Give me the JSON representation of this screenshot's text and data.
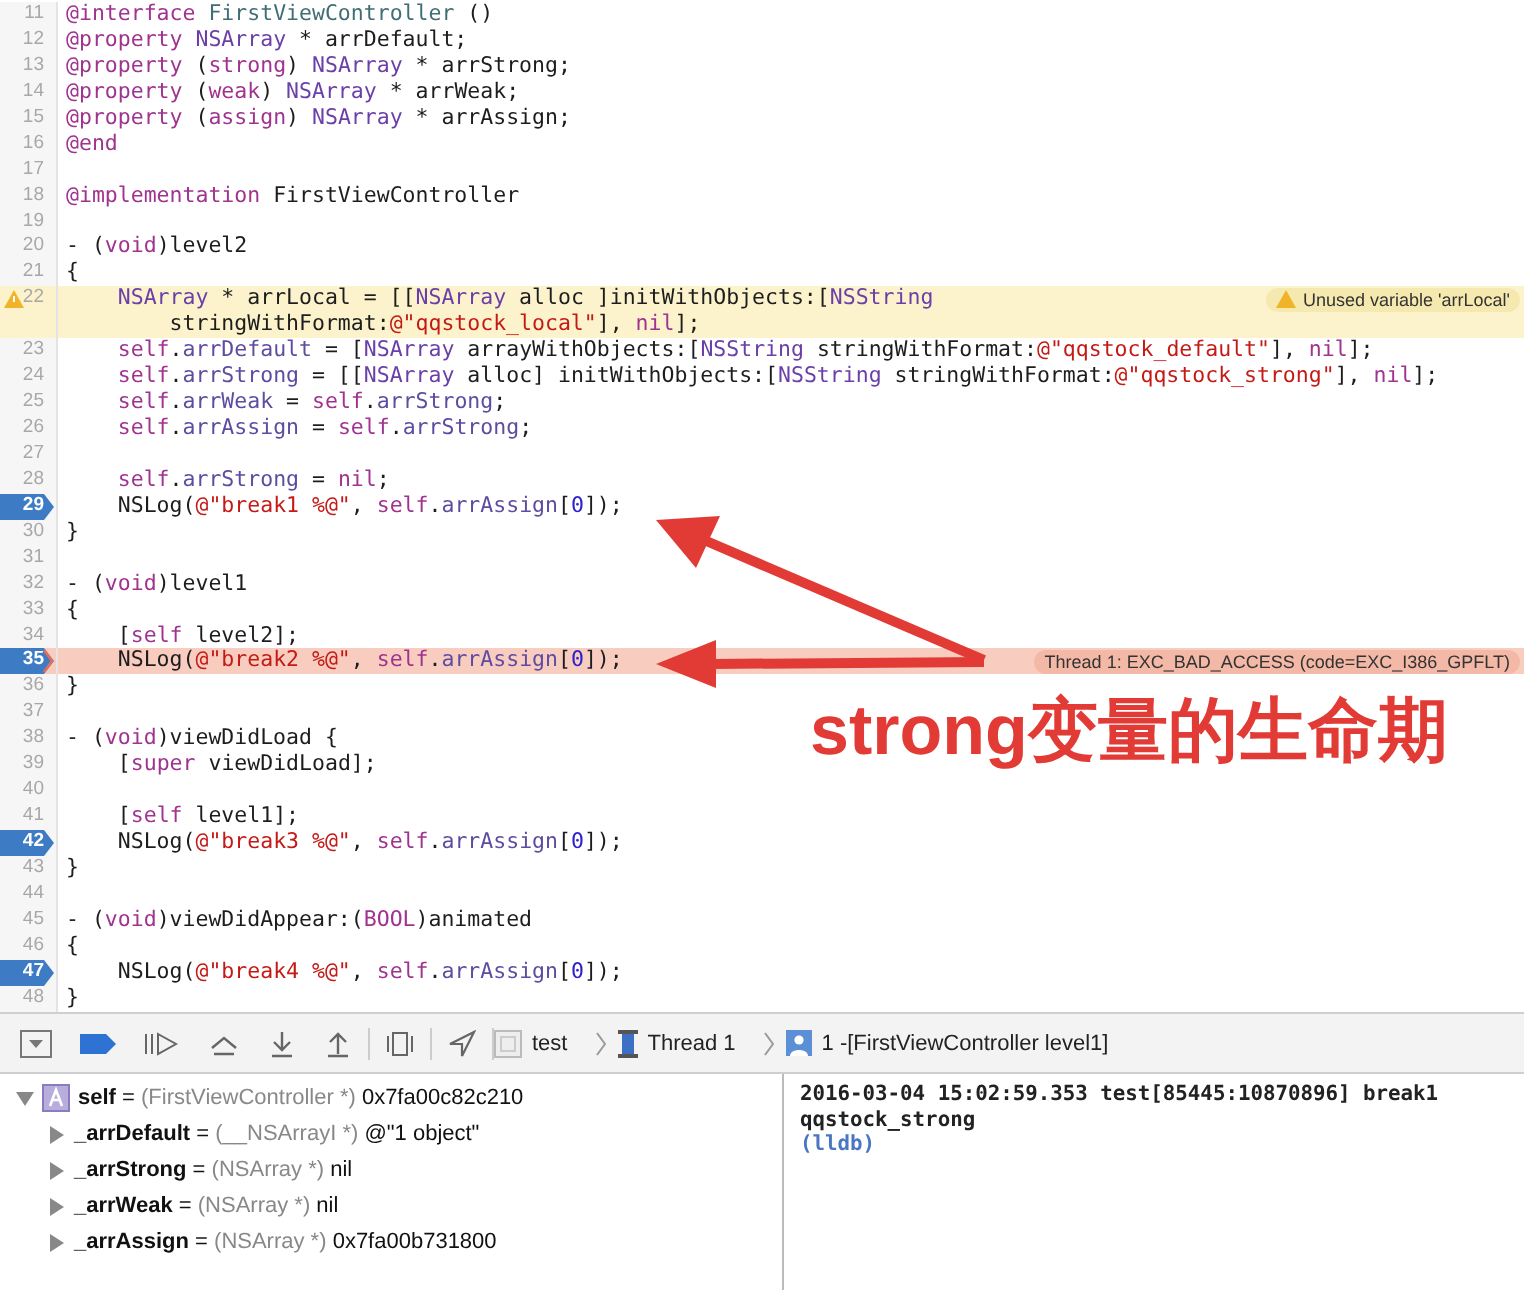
{
  "editor": {
    "lines": [
      {
        "num": "11",
        "segments": [
          {
            "kind": "kw",
            "t": "@interface"
          },
          {
            "kind": "de",
            "t": " FirstViewController"
          },
          {
            "kind": "p",
            "t": " ()"
          }
        ]
      },
      {
        "num": "12",
        "segments": [
          {
            "kind": "kw",
            "t": "@property "
          },
          {
            "kind": "ty",
            "t": "NSArray"
          },
          {
            "kind": "p",
            "t": " * arrDefault;"
          }
        ]
      },
      {
        "num": "13",
        "segments": [
          {
            "kind": "kw",
            "t": "@property"
          },
          {
            "kind": "p",
            "t": " ("
          },
          {
            "kind": "kw",
            "t": "strong"
          },
          {
            "kind": "p",
            "t": ") "
          },
          {
            "kind": "ty",
            "t": "NSArray"
          },
          {
            "kind": "p",
            "t": " * arrStrong;"
          }
        ]
      },
      {
        "num": "14",
        "segments": [
          {
            "kind": "kw",
            "t": "@property"
          },
          {
            "kind": "p",
            "t": " ("
          },
          {
            "kind": "kw",
            "t": "weak"
          },
          {
            "kind": "p",
            "t": ") "
          },
          {
            "kind": "ty",
            "t": "NSArray"
          },
          {
            "kind": "p",
            "t": " * arrWeak;"
          }
        ]
      },
      {
        "num": "15",
        "segments": [
          {
            "kind": "kw",
            "t": "@property"
          },
          {
            "kind": "p",
            "t": " ("
          },
          {
            "kind": "kw",
            "t": "assign"
          },
          {
            "kind": "p",
            "t": ") "
          },
          {
            "kind": "ty",
            "t": "NSArray"
          },
          {
            "kind": "p",
            "t": " * arrAssign;"
          }
        ]
      },
      {
        "num": "16",
        "segments": [
          {
            "kind": "kw",
            "t": "@end"
          }
        ]
      },
      {
        "num": "17"
      },
      {
        "num": "18",
        "segments": [
          {
            "kind": "kw",
            "t": "@implementation"
          },
          {
            "kind": "p",
            "t": " FirstViewController"
          }
        ]
      },
      {
        "num": "19"
      },
      {
        "num": "20",
        "segments": [
          {
            "kind": "p",
            "t": "- ("
          },
          {
            "kind": "kw",
            "t": "void"
          },
          {
            "kind": "p",
            "t": ")level2"
          }
        ]
      },
      {
        "num": "21",
        "segments": [
          {
            "kind": "p",
            "t": "{"
          }
        ]
      },
      {
        "num": "22",
        "note": {
          "kind": "warning",
          "text": "Unused variable 'arrLocal'"
        },
        "segments": [
          {
            "kind": "ty",
            "t": "    NSArray"
          },
          {
            "kind": "p",
            "t": " * arrLocal = [["
          },
          {
            "kind": "ty",
            "t": "NSArray"
          },
          {
            "kind": "p",
            "t": " alloc ]initWithObjects:["
          },
          {
            "kind": "ty",
            "t": "NSString"
          }
        ],
        "continuation": [
          {
            "kind": "p",
            "t": "        stringWithFormat:"
          },
          {
            "kind": "str",
            "t": "@\"qqstock_local\""
          },
          {
            "kind": "p",
            "t": "], "
          },
          {
            "kind": "kw",
            "t": "nil"
          },
          {
            "kind": "p",
            "t": "];"
          }
        ]
      },
      {
        "num": "23",
        "segments": [
          {
            "kind": "kw",
            "t": "    self"
          },
          {
            "kind": "p",
            "t": "."
          },
          {
            "kind": "pr",
            "t": "arrDefault"
          },
          {
            "kind": "p",
            "t": " = ["
          },
          {
            "kind": "ty",
            "t": "NSArray"
          },
          {
            "kind": "p",
            "t": " arrayWithObjects:["
          },
          {
            "kind": "ty",
            "t": "NSString"
          },
          {
            "kind": "p",
            "t": " stringWithFormat:"
          },
          {
            "kind": "str",
            "t": "@\"qqstock_default\""
          },
          {
            "kind": "p",
            "t": "], "
          },
          {
            "kind": "kw",
            "t": "nil"
          },
          {
            "kind": "p",
            "t": "];"
          }
        ]
      },
      {
        "num": "24",
        "segments": [
          {
            "kind": "kw",
            "t": "    self"
          },
          {
            "kind": "p",
            "t": "."
          },
          {
            "kind": "pr",
            "t": "arrStrong"
          },
          {
            "kind": "p",
            "t": " = [["
          },
          {
            "kind": "ty",
            "t": "NSArray"
          },
          {
            "kind": "p",
            "t": " alloc] initWithObjects:["
          },
          {
            "kind": "ty",
            "t": "NSString"
          },
          {
            "kind": "p",
            "t": " stringWithFormat:"
          },
          {
            "kind": "str",
            "t": "@\"qqstock_strong\""
          },
          {
            "kind": "p",
            "t": "], "
          },
          {
            "kind": "kw",
            "t": "nil"
          },
          {
            "kind": "p",
            "t": "];"
          }
        ]
      },
      {
        "num": "25",
        "segments": [
          {
            "kind": "kw",
            "t": "    self"
          },
          {
            "kind": "p",
            "t": "."
          },
          {
            "kind": "pr",
            "t": "arrWeak"
          },
          {
            "kind": "p",
            "t": " = "
          },
          {
            "kind": "kw",
            "t": "self"
          },
          {
            "kind": "p",
            "t": "."
          },
          {
            "kind": "pr",
            "t": "arrStrong"
          },
          {
            "kind": "p",
            "t": ";"
          }
        ]
      },
      {
        "num": "26",
        "segments": [
          {
            "kind": "kw",
            "t": "    self"
          },
          {
            "kind": "p",
            "t": "."
          },
          {
            "kind": "pr",
            "t": "arrAssign"
          },
          {
            "kind": "p",
            "t": " = "
          },
          {
            "kind": "kw",
            "t": "self"
          },
          {
            "kind": "p",
            "t": "."
          },
          {
            "kind": "pr",
            "t": "arrStrong"
          },
          {
            "kind": "p",
            "t": ";"
          }
        ]
      },
      {
        "num": "27"
      },
      {
        "num": "28",
        "segments": [
          {
            "kind": "kw",
            "t": "    self"
          },
          {
            "kind": "p",
            "t": "."
          },
          {
            "kind": "pr",
            "t": "arrStrong"
          },
          {
            "kind": "p",
            "t": " = "
          },
          {
            "kind": "kw",
            "t": "nil"
          },
          {
            "kind": "p",
            "t": ";"
          }
        ]
      },
      {
        "num": "29",
        "breakpoint": true,
        "current": false,
        "segments": [
          {
            "kind": "p",
            "t": "    NSLog("
          },
          {
            "kind": "str",
            "t": "@\"break1 %@\""
          },
          {
            "kind": "p",
            "t": ", "
          },
          {
            "kind": "kw",
            "t": "self"
          },
          {
            "kind": "p",
            "t": "."
          },
          {
            "kind": "pr",
            "t": "arrAssign"
          },
          {
            "kind": "p",
            "t": "["
          },
          {
            "kind": "num",
            "t": "0"
          },
          {
            "kind": "p",
            "t": "]);"
          }
        ]
      },
      {
        "num": "30",
        "segments": [
          {
            "kind": "p",
            "t": "}"
          }
        ]
      },
      {
        "num": "31"
      },
      {
        "num": "32",
        "segments": [
          {
            "kind": "p",
            "t": "- ("
          },
          {
            "kind": "kw",
            "t": "void"
          },
          {
            "kind": "p",
            "t": ")level1"
          }
        ]
      },
      {
        "num": "33",
        "segments": [
          {
            "kind": "p",
            "t": "{"
          }
        ]
      },
      {
        "num": "34",
        "segments": [
          {
            "kind": "p",
            "t": "    ["
          },
          {
            "kind": "kw",
            "t": "self"
          },
          {
            "kind": "p",
            "t": " level2];"
          }
        ]
      },
      {
        "num": "35",
        "breakpoint": true,
        "current": true,
        "note": {
          "kind": "error",
          "text": "Thread 1: EXC_BAD_ACCESS (code=EXC_I386_GPFLT)"
        },
        "segments": [
          {
            "kind": "p",
            "t": "    NSLog("
          },
          {
            "kind": "str",
            "t": "@\"break2 %@\""
          },
          {
            "kind": "p",
            "t": ", "
          },
          {
            "kind": "kw",
            "t": "self"
          },
          {
            "kind": "p",
            "t": "."
          },
          {
            "kind": "pr",
            "t": "arrAssign"
          },
          {
            "kind": "p",
            "t": "["
          },
          {
            "kind": "num",
            "t": "0"
          },
          {
            "kind": "p",
            "t": "]);"
          }
        ]
      },
      {
        "num": "36",
        "segments": [
          {
            "kind": "p",
            "t": "}"
          }
        ]
      },
      {
        "num": "37"
      },
      {
        "num": "38",
        "segments": [
          {
            "kind": "p",
            "t": "- ("
          },
          {
            "kind": "kw",
            "t": "void"
          },
          {
            "kind": "p",
            "t": ")viewDidLoad {"
          }
        ]
      },
      {
        "num": "39",
        "segments": [
          {
            "kind": "p",
            "t": "    ["
          },
          {
            "kind": "kw",
            "t": "super"
          },
          {
            "kind": "p",
            "t": " viewDidLoad];"
          }
        ]
      },
      {
        "num": "40"
      },
      {
        "num": "41",
        "segments": [
          {
            "kind": "p",
            "t": "    ["
          },
          {
            "kind": "kw",
            "t": "self"
          },
          {
            "kind": "p",
            "t": " level1];"
          }
        ]
      },
      {
        "num": "42",
        "breakpoint": true,
        "current": false,
        "segments": [
          {
            "kind": "p",
            "t": "    NSLog("
          },
          {
            "kind": "str",
            "t": "@\"break3 %@\""
          },
          {
            "kind": "p",
            "t": ", "
          },
          {
            "kind": "kw",
            "t": "self"
          },
          {
            "kind": "p",
            "t": "."
          },
          {
            "kind": "pr",
            "t": "arrAssign"
          },
          {
            "kind": "p",
            "t": "["
          },
          {
            "kind": "num",
            "t": "0"
          },
          {
            "kind": "p",
            "t": "]);"
          }
        ]
      },
      {
        "num": "43",
        "segments": [
          {
            "kind": "p",
            "t": "}"
          }
        ]
      },
      {
        "num": "44"
      },
      {
        "num": "45",
        "segments": [
          {
            "kind": "p",
            "t": "- ("
          },
          {
            "kind": "kw",
            "t": "void"
          },
          {
            "kind": "p",
            "t": ")viewDidAppear:("
          },
          {
            "kind": "kw",
            "t": "BOOL"
          },
          {
            "kind": "p",
            "t": ")animated"
          }
        ]
      },
      {
        "num": "46",
        "segments": [
          {
            "kind": "p",
            "t": "{"
          }
        ]
      },
      {
        "num": "47",
        "breakpoint": true,
        "current": false,
        "segments": [
          {
            "kind": "p",
            "t": "    NSLog("
          },
          {
            "kind": "str",
            "t": "@\"break4 %@\""
          },
          {
            "kind": "p",
            "t": ", "
          },
          {
            "kind": "kw",
            "t": "self"
          },
          {
            "kind": "p",
            "t": "."
          },
          {
            "kind": "pr",
            "t": "arrAssign"
          },
          {
            "kind": "p",
            "t": "["
          },
          {
            "kind": "num",
            "t": "0"
          },
          {
            "kind": "p",
            "t": "]);"
          }
        ]
      },
      {
        "num": "48",
        "segments": [
          {
            "kind": "p",
            "t": "}"
          }
        ]
      }
    ]
  },
  "debug_bar": {
    "breakpoints_active": true,
    "breadcrumb": [
      {
        "kind": "process",
        "label": "test"
      },
      {
        "kind": "thread",
        "label": "Thread 1"
      },
      {
        "kind": "frame",
        "label": "1 -[FirstViewController level1]"
      }
    ]
  },
  "variables": [
    {
      "name": "self",
      "sign": "=",
      "type": "(FirstViewController *)",
      "value": "0x7fa00c82c210",
      "expanded": true,
      "children": [
        {
          "name": "_arrDefault",
          "sign": "=",
          "type": "(__NSArrayI *)",
          "value": "@\"1 object\"",
          "expanded": false
        },
        {
          "name": "_arrStrong",
          "sign": "=",
          "type": "(NSArray *)",
          "value": "nil",
          "expanded": false
        },
        {
          "name": "_arrWeak",
          "sign": "=",
          "type": "(NSArray *)",
          "value": "nil",
          "expanded": false
        },
        {
          "name": "_arrAssign",
          "sign": "=",
          "type": "(NSArray *)",
          "value": "0x7fa00b731800",
          "expanded": false
        }
      ]
    }
  ],
  "console": [
    {
      "kind": "output",
      "text": "2016-03-04 15:02:59.353 test[85445:10870896] break1"
    },
    {
      "kind": "output",
      "text": "qqstock_strong"
    },
    {
      "kind": "prompt",
      "text": "(lldb)"
    }
  ],
  "annotation": {
    "text": "strong变量的生命期"
  }
}
